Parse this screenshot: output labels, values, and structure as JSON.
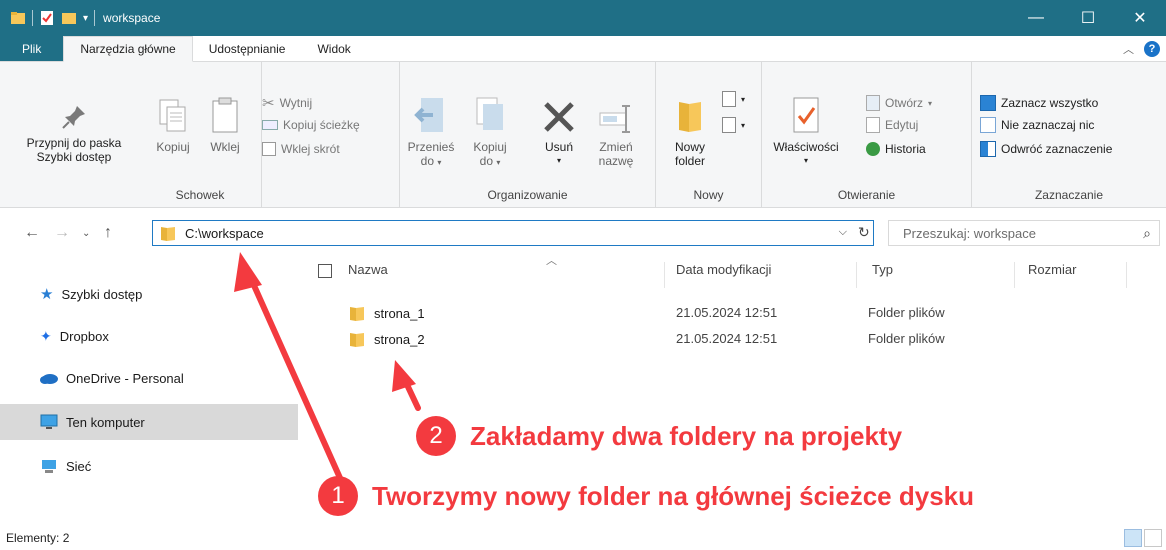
{
  "window": {
    "title": "workspace",
    "minimize": "—",
    "maximize": "☐",
    "close": "✕"
  },
  "tabs": [
    {
      "label": "Plik"
    },
    {
      "label": "Narzędzia główne"
    },
    {
      "label": "Udostępnianie"
    },
    {
      "label": "Widok"
    }
  ],
  "ribbon": {
    "schowek": {
      "label": "Schowek",
      "pin_line1": "Przypnij do paska",
      "pin_line2": "Szybki dostęp",
      "copy": "Kopiuj",
      "paste": "Wklej",
      "cut": "Wytnij",
      "copy_path": "Kopiuj ścieżkę",
      "paste_shortcut": "Wklej skrót"
    },
    "organizowanie": {
      "label": "Organizowanie",
      "move_line1": "Przenieś",
      "move_line2": "do",
      "copy_line1": "Kopiuj",
      "copy_line2": "do",
      "delete": "Usuń",
      "rename_line1": "Zmień",
      "rename_line2": "nazwę"
    },
    "nowy": {
      "label": "Nowy",
      "new_folder_line1": "Nowy",
      "new_folder_line2": "folder"
    },
    "otwieranie": {
      "label": "Otwieranie",
      "properties": "Właściwości",
      "open": "Otwórz",
      "edit": "Edytuj",
      "history": "Historia"
    },
    "zaznaczanie": {
      "label": "Zaznaczanie",
      "select_all": "Zaznacz wszystko",
      "select_none": "Nie zaznaczaj nic",
      "invert": "Odwróć zaznaczenie"
    }
  },
  "address": {
    "path": "C:\\workspace",
    "search_placeholder": "Przeszukaj: workspace"
  },
  "sidebar": {
    "items": [
      {
        "label": "Szybki dostęp",
        "icon": "star-icon"
      },
      {
        "label": "Dropbox",
        "icon": "dropbox-icon"
      },
      {
        "label": "OneDrive - Personal",
        "icon": "cloud-icon"
      },
      {
        "label": "Ten komputer",
        "icon": "computer-icon"
      },
      {
        "label": "Sieć",
        "icon": "network-icon"
      }
    ]
  },
  "columns": {
    "name": "Nazwa",
    "date": "Data modyfikacji",
    "type": "Typ",
    "size": "Rozmiar"
  },
  "files": [
    {
      "name": "strona_1",
      "date": "21.05.2024 12:51",
      "type": "Folder plików"
    },
    {
      "name": "strona_2",
      "date": "21.05.2024 12:51",
      "type": "Folder plików"
    }
  ],
  "annotations": [
    {
      "number": "1",
      "text": "Tworzymy nowy folder na głównej ścieżce dysku"
    },
    {
      "number": "2",
      "text": "Zakładamy dwa foldery na projekty"
    }
  ],
  "status": {
    "items_count": "Elementy: 2"
  },
  "colors": {
    "titlebar": "#1f6f86",
    "accent": "#1f7ac4",
    "annotation": "#f33a3f",
    "folder": "#f7c75a"
  }
}
